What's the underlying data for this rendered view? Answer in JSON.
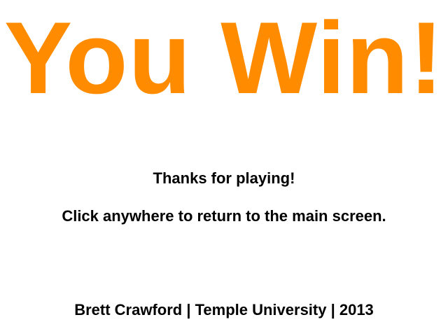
{
  "colors": {
    "title": "#ff8c00",
    "text": "#000000",
    "background": "#ffffff"
  },
  "win_screen": {
    "title": "You Win!",
    "thanks": "Thanks for playing!",
    "instruction": "Click anywhere to return to the main screen.",
    "credits": "Brett Crawford | Temple University | 2013"
  }
}
